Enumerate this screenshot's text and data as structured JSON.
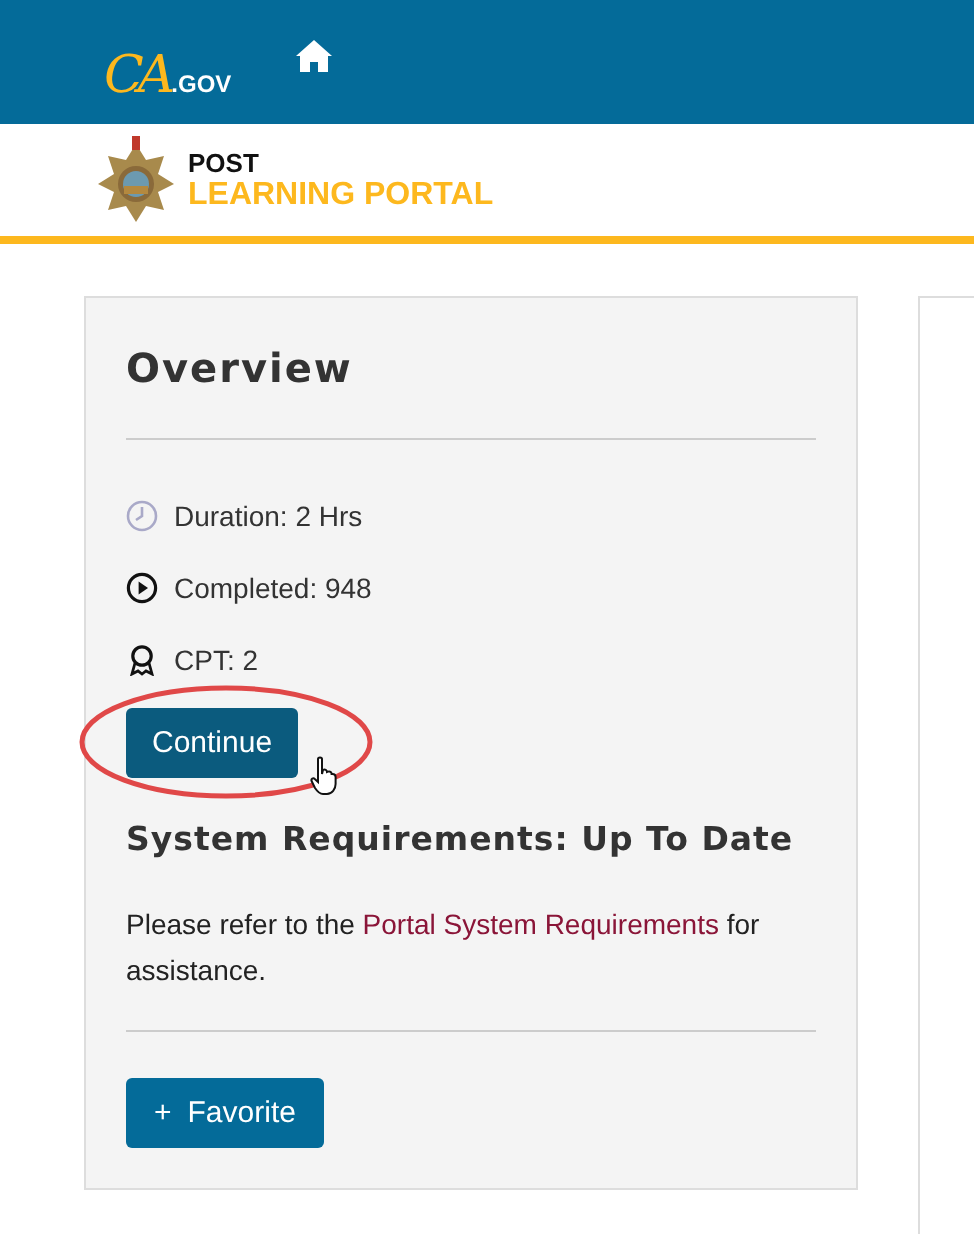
{
  "header": {
    "logo": {
      "script": "CA",
      "suffix": ".GOV"
    },
    "brand": {
      "line1": "POST",
      "line2": "LEARNING PORTAL"
    }
  },
  "overview": {
    "title": "Overview",
    "facts": [
      {
        "kind": "clock",
        "text": "Duration: 2 Hrs"
      },
      {
        "kind": "play",
        "text": "Completed: 948"
      },
      {
        "kind": "award",
        "text": "CPT: 2"
      }
    ],
    "primary_button": "Continue",
    "requirements": {
      "title": "System Requirements: Up To Date",
      "before": "Please refer to the ",
      "link": "Portal System Requirements",
      "after": " for assistance."
    },
    "favorite_button": {
      "icon": "+",
      "label": "Favorite"
    }
  }
}
